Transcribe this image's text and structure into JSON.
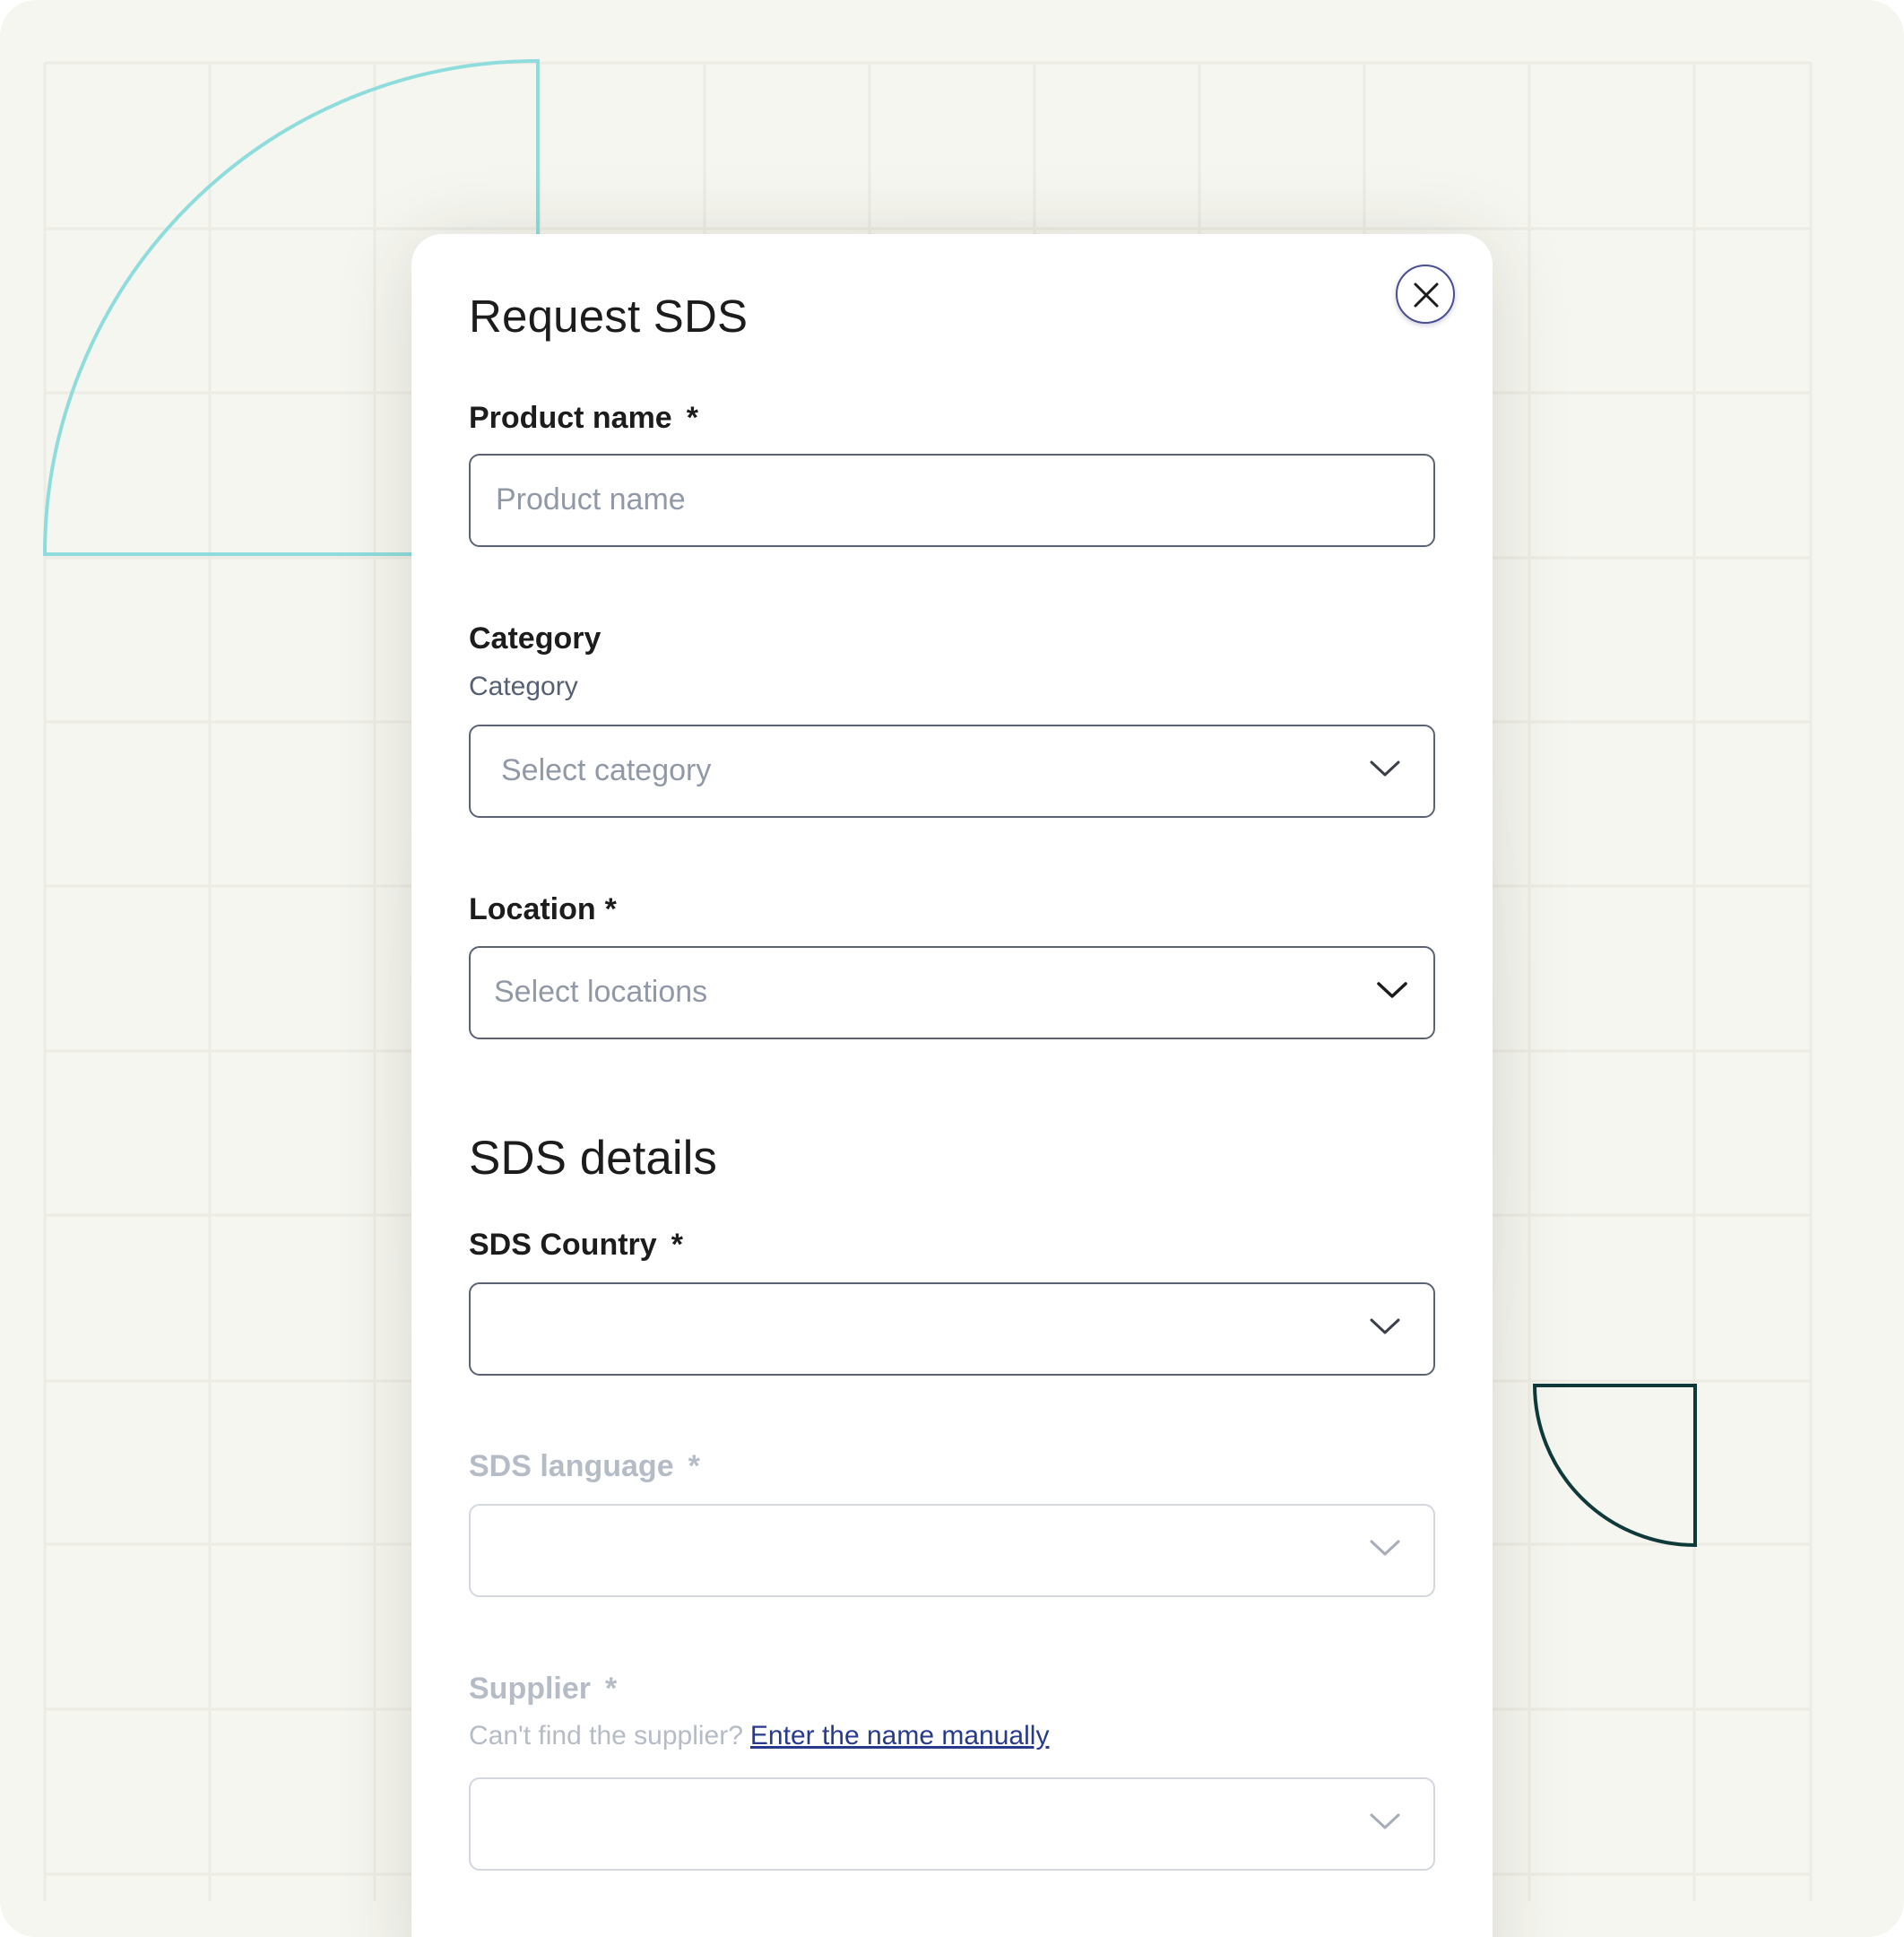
{
  "modal": {
    "title": "Request SDS",
    "close_icon": "close-icon"
  },
  "form": {
    "product_name": {
      "label": "Product name",
      "required_mark": "*",
      "placeholder": "Product name",
      "value": ""
    },
    "category": {
      "label": "Category",
      "helper": "Category",
      "placeholder": "Select category",
      "icon": "chevron-down-icon"
    },
    "location": {
      "label": "Location",
      "required_mark": "*",
      "placeholder": "Select locations",
      "icon": "chevron-down-icon"
    },
    "sds_details": {
      "heading": "SDS details"
    },
    "sds_country": {
      "label": "SDS Country",
      "required_mark": "*",
      "value": "",
      "icon": "chevron-down-icon"
    },
    "sds_language": {
      "label": "SDS language",
      "required_mark": "*",
      "value": "",
      "disabled": true,
      "icon": "chevron-down-icon"
    },
    "supplier": {
      "label": "Supplier",
      "required_mark": "*",
      "helper": "Can't find the supplier?",
      "link": "Enter the name manually",
      "value": "",
      "disabled": true,
      "icon": "chevron-down-icon"
    }
  },
  "colors": {
    "background": "#f6f6f0",
    "accent_teal": "#8fdcdc",
    "accent_dark": "#0f3a3a",
    "link": "#283a8c",
    "close_border": "#4a4f90"
  }
}
